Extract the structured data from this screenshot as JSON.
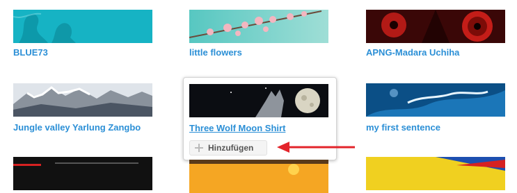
{
  "gallery": {
    "items": [
      {
        "title": "BLUE73"
      },
      {
        "title": "little flowers"
      },
      {
        "title": "APNG-Madara Uchiha"
      },
      {
        "title": "Jungle valley Yarlung Zangbo"
      },
      {
        "title": "Three Wolf Moon Shirt"
      },
      {
        "title": "my first sentence"
      }
    ]
  },
  "popup": {
    "add_label": "Hinzufügen",
    "add_icon": "plus-icon"
  },
  "annotation": {
    "arrow_color": "#e3242b"
  },
  "colors": {
    "link": "#2b8fd6"
  }
}
